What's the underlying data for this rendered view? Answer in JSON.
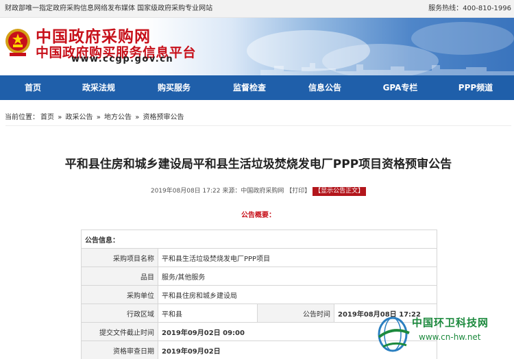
{
  "topbar": {
    "left": "财政部唯一指定政府采购信息网络发布媒体  国家级政府采购专业网站",
    "right": "服务热线：400-810-1996"
  },
  "header": {
    "logo_title": "中国政府采购网",
    "logo_subtitle": "中国政府购买服务信息平台",
    "logo_url": "www.ccgp.gov.cn"
  },
  "nav": {
    "items": [
      {
        "label": "首页"
      },
      {
        "label": "政采法规"
      },
      {
        "label": "购买服务"
      },
      {
        "label": "监督检查"
      },
      {
        "label": "信息公告"
      },
      {
        "label": "GPA专栏"
      },
      {
        "label": "PPP频道"
      }
    ]
  },
  "breadcrumb": {
    "prefix": "当前位置：",
    "items": [
      "首页",
      "政采公告",
      "地方公告",
      "资格预审公告"
    ],
    "separator": "»"
  },
  "article": {
    "title": "平和县住房和城乡建设局平和县生活垃圾焚烧发电厂PPP项目资格预审公告",
    "meta_date": "2019年08月08日 17:22",
    "meta_source": "来源：中国政府采购网",
    "meta_print": "【打印】",
    "meta_button": "【显示公告正文】",
    "summary_label": "公告概要："
  },
  "info_table": {
    "header": "公告信息：",
    "rows": {
      "project_name_label": "采购项目名称",
      "project_name_value": "平和县生活垃圾焚烧发电厂PPP项目",
      "category_label": "品目",
      "category_value": "服务/其他服务",
      "unit_label": "采购单位",
      "unit_value": "平和县住房和城乡建设局",
      "region_label": "行政区域",
      "region_value": "平和县",
      "pubtime_label": "公告时间",
      "pubtime_value": "2019年08月08日  17:22",
      "deadline_label": "提交文件截止时间",
      "deadline_value": "2019年09月02日 09:00",
      "review_label": "资格审查日期",
      "review_value": "2019年09月02日"
    }
  },
  "watermark": {
    "title": "中国环卫科技网",
    "url": "www.cn-hw.net"
  },
  "colors": {
    "nav_bg": "#1f5faa",
    "brand_red": "#c7101a",
    "watermark_green": "#1d8a3e"
  }
}
